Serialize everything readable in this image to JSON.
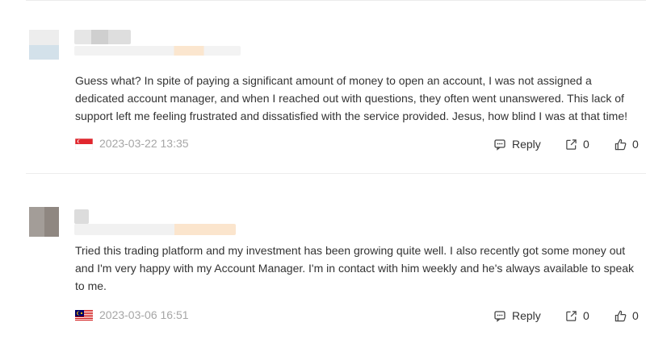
{
  "comments": [
    {
      "text": "Guess what? In spite of paying a significant amount of money to open an account, I was not assigned a dedicated account manager, and when I reached out with questions, they often went unanswered. This lack of support left me feeling frustrated and dissatisfied with the service provided. Jesus, how blind I was at that time!",
      "flag": "singapore-flag-icon",
      "date": "2023-03-22 13:35",
      "reply_label": "Reply",
      "share_count": "0",
      "like_count": "0"
    },
    {
      "text": "Tried this trading platform and my investment has been growing quite well. I also recently got some money out and I'm very happy with my Account Manager. I'm in contact with him weekly and he's always available to speak to me.",
      "flag": "malaysia-flag-icon",
      "date": "2023-03-06 16:51",
      "reply_label": "Reply",
      "share_count": "0",
      "like_count": "0"
    }
  ],
  "colors": {
    "text": "#333333",
    "meta": "#a6a6a6",
    "divider": "#ececec"
  }
}
